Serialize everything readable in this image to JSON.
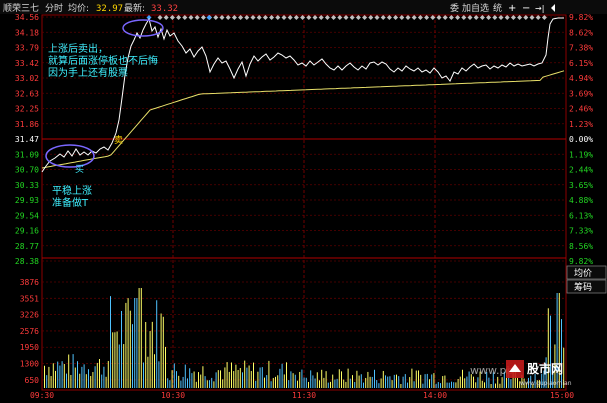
{
  "header": {
    "stock_name": "顺荣三七",
    "view": "分时",
    "avg_label": "均价:",
    "avg_value": "32.97",
    "last_label": "最新:",
    "last_value": "33.32",
    "toolbar": {
      "sell_hint": "委",
      "add_watch": "加自选",
      "stats": "统",
      "zoom_in": "+",
      "zoom_out": "−",
      "next_icon": "→|"
    }
  },
  "price_axis": {
    "left_ticks": [
      "34.56",
      "34.18",
      "33.79",
      "33.42",
      "33.02",
      "32.63",
      "32.25",
      "31.86",
      "31.47",
      "31.09",
      "30.70",
      "30.33",
      "29.93",
      "29.54",
      "29.16",
      "28.77",
      "28.38"
    ],
    "right_ticks": [
      "9.82%",
      "8.62%",
      "7.38%",
      "6.15%",
      "4.94%",
      "3.69%",
      "2.46%",
      "1.23%",
      "0.00%",
      "1.19%",
      "2.44%",
      "3.65%",
      "4.88%",
      "6.13%",
      "7.33%",
      "8.56%",
      "9.82%"
    ]
  },
  "volume_axis": {
    "ticks": [
      "3876",
      "3551",
      "3226",
      "2576",
      "1950",
      "1300",
      "650"
    ]
  },
  "time_axis": {
    "ticks": [
      "09:30",
      "10:30",
      "11:30",
      "14:00",
      "15:00"
    ]
  },
  "side_tabs": {
    "avg": "均价",
    "chips": "筹码"
  },
  "annotations": {
    "note_top_1": "上涨后卖出，",
    "note_top_2": "就算后面涨停板也不后悔",
    "note_top_3": "因为手上还有股票",
    "buy_label": "买",
    "sell_label": "卖",
    "note_bottom_1": "平稳上涨",
    "note_bottom_2": "准备做T"
  },
  "watermark": {
    "text": "股市网",
    "url": "www.gupiaomian",
    "prefix": "www.pb"
  },
  "colors": {
    "price_line": "#ffffff",
    "avg_line": "#e8e06a",
    "up_red": "#ff3b3b",
    "down_green": "#22d622",
    "annotation": "#3ff0ff",
    "grid": "#8b0000",
    "volume": "#ffff66"
  }
}
